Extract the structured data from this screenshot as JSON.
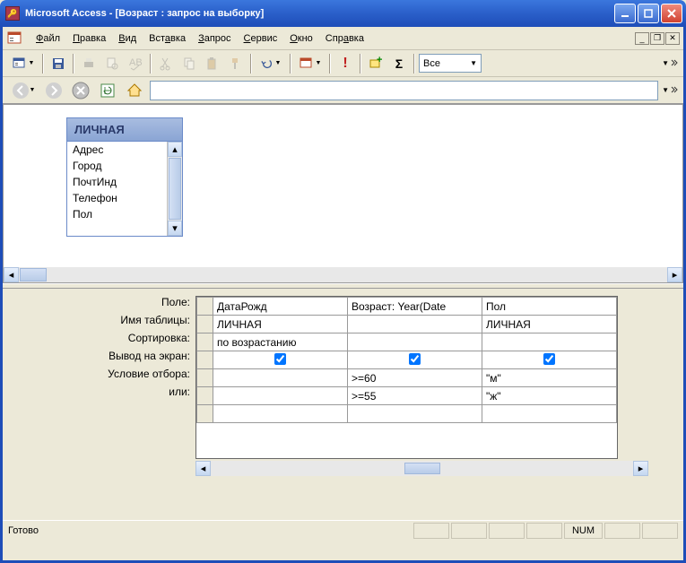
{
  "window": {
    "title": "Microsoft Access - [Возраст : запрос на выборку]"
  },
  "menu": {
    "file": "Файл",
    "edit": "Правка",
    "view": "Вид",
    "insert": "Вставка",
    "query": "Запрос",
    "service": "Сервис",
    "window": "Окно",
    "help": "Справка"
  },
  "toolbar": {
    "combo_value": "Все"
  },
  "table_panel": {
    "name": "ЛИЧНАЯ",
    "fields": [
      "Адрес",
      "Город",
      "ПочтИнд",
      "Телефон",
      "Пол"
    ]
  },
  "design_grid": {
    "row_labels": {
      "field": "Поле:",
      "table": "Имя таблицы:",
      "sort": "Сортировка:",
      "show": "Вывод на экран:",
      "criteria": "Условие отбора:",
      "or": "или:"
    },
    "columns": [
      {
        "field": "ДатаРожд",
        "table": "ЛИЧНАЯ",
        "sort": "по возрастанию",
        "show": true,
        "criteria": "",
        "or": ""
      },
      {
        "field": "Возраст: Year(Date",
        "table": "",
        "sort": "",
        "show": true,
        "criteria": ">=60",
        "or": ">=55"
      },
      {
        "field": "Пол",
        "table": "ЛИЧНАЯ",
        "sort": "",
        "show": true,
        "criteria": "\"м\"",
        "or": "\"ж\""
      }
    ]
  },
  "status": {
    "text": "Готово",
    "num": "NUM"
  }
}
